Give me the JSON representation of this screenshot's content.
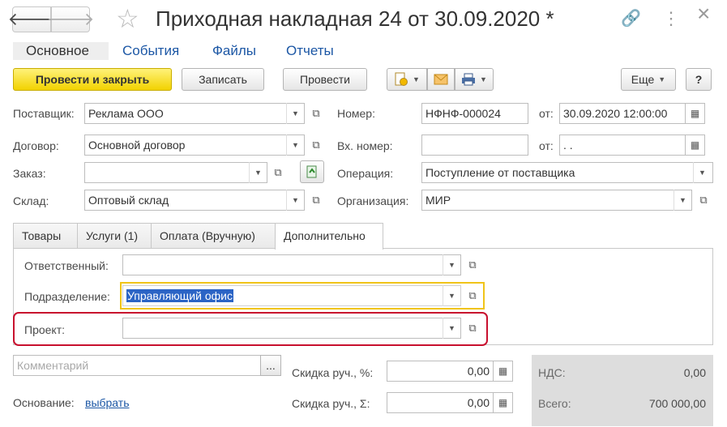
{
  "header": {
    "title": "Приходная накладная 24 от 30.09.2020 *",
    "back_glyph": "🡐",
    "forward_glyph": "🡒",
    "star_glyph": "☆",
    "link_glyph": "🔗",
    "more_glyph": "⋮",
    "close_glyph": "×"
  },
  "tabs": [
    {
      "label": "Основное"
    },
    {
      "label": "События"
    },
    {
      "label": "Файлы"
    },
    {
      "label": "Отчеты"
    }
  ],
  "toolbar": {
    "post_close": "Провести и закрыть",
    "save": "Записать",
    "post": "Провести",
    "more": "Еще",
    "help": "?"
  },
  "fields": {
    "supplier": {
      "label": "Поставщик:",
      "value": "Реклама ООО"
    },
    "contract": {
      "label": "Договор:",
      "value": "Основной договор"
    },
    "order": {
      "label": "Заказ:",
      "value": ""
    },
    "warehouse": {
      "label": "Склад:",
      "value": "Оптовый склад"
    },
    "number": {
      "label": "Номер:",
      "value": "НФНФ-000024"
    },
    "date_label": "от:",
    "date": "30.09.2020 12:00:00",
    "incoming_number": {
      "label": "Вх. номер:",
      "value": ""
    },
    "incoming_date_label": "от:",
    "incoming_date": " .  .",
    "operation": {
      "label": "Операция:",
      "value": "Поступление от поставщика"
    },
    "organization": {
      "label": "Организация:",
      "value": "МИР"
    }
  },
  "form_tabs": [
    {
      "label": "Товары"
    },
    {
      "label": "Услуги (1)"
    },
    {
      "label": "Оплата (Вручную)"
    },
    {
      "label": "Дополнительно"
    }
  ],
  "extra": {
    "responsible": {
      "label": "Ответственный:",
      "value": ""
    },
    "department": {
      "label": "Подразделение:",
      "value": "Управляющий офис"
    },
    "project": {
      "label": "Проект:",
      "value": ""
    }
  },
  "footer": {
    "comment_placeholder": "Комментарий",
    "comment_btn": "...",
    "basis_label": "Основание:",
    "basis_link": "выбрать",
    "discount_pct_label": "Скидка руч., %:",
    "discount_pct": "0,00",
    "discount_sum_label": "Скидка руч., Σ:",
    "discount_sum": "0,00",
    "vat_label": "НДС:",
    "vat": "0,00",
    "total_label": "Всего:",
    "total": "700 000,00"
  },
  "colors": {
    "primary_button": "#f2d200",
    "link": "#1c57a5",
    "selection": "#2b64c5",
    "focus_border": "#f0c419",
    "highlight_frame": "#c8102e"
  }
}
